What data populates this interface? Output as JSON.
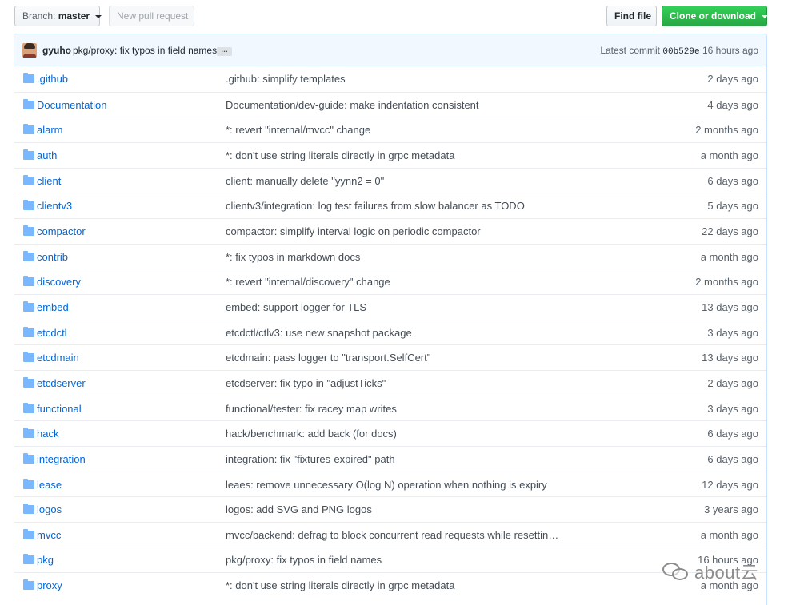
{
  "toolbar": {
    "branch_label": "Branch:",
    "branch_value": "master",
    "new_pr_label": "New pull request",
    "find_file_label": "Find file",
    "clone_label": "Clone or download"
  },
  "commit": {
    "author": "gyuho",
    "message": "pkg/proxy: fix typos in field names",
    "ellipsis": "…",
    "latest_label": "Latest commit",
    "sha": "00b529e",
    "age": "16 hours ago"
  },
  "files": [
    {
      "name": ".github",
      "message": ".github: simplify templates",
      "age": "2 days ago"
    },
    {
      "name": "Documentation",
      "message": "Documentation/dev-guide: make indentation consistent",
      "age": "4 days ago"
    },
    {
      "name": "alarm",
      "message": "*: revert \"internal/mvcc\" change",
      "age": "2 months ago"
    },
    {
      "name": "auth",
      "message": "*: don't use string literals directly in grpc metadata",
      "age": "a month ago"
    },
    {
      "name": "client",
      "message": "client: manually delete \"yynn2 = 0\"",
      "age": "6 days ago"
    },
    {
      "name": "clientv3",
      "message": "clientv3/integration: log test failures from slow balancer as TODO",
      "age": "5 days ago"
    },
    {
      "name": "compactor",
      "message": "compactor: simplify interval logic on periodic compactor",
      "age": "22 days ago"
    },
    {
      "name": "contrib",
      "message": "*: fix typos in markdown docs",
      "age": "a month ago"
    },
    {
      "name": "discovery",
      "message": "*: revert \"internal/discovery\" change",
      "age": "2 months ago"
    },
    {
      "name": "embed",
      "message": "embed: support logger for TLS",
      "age": "13 days ago"
    },
    {
      "name": "etcdctl",
      "message": "etcdctl/ctlv3: use new snapshot package",
      "age": "3 days ago"
    },
    {
      "name": "etcdmain",
      "message": "etcdmain: pass logger to \"transport.SelfCert\"",
      "age": "13 days ago"
    },
    {
      "name": "etcdserver",
      "message": "etcdserver: fix typo in \"adjustTicks\"",
      "age": "2 days ago"
    },
    {
      "name": "functional",
      "message": "functional/tester: fix racey map writes",
      "age": "3 days ago"
    },
    {
      "name": "hack",
      "message": "hack/benchmark: add back (for docs)",
      "age": "6 days ago"
    },
    {
      "name": "integration",
      "message": "integration: fix \"fixtures-expired\" path",
      "age": "6 days ago"
    },
    {
      "name": "lease",
      "message": "leaes: remove unnecessary O(log N) operation when nothing is expiry",
      "age": "12 days ago"
    },
    {
      "name": "logos",
      "message": "logos: add SVG and PNG logos",
      "age": "3 years ago"
    },
    {
      "name": "mvcc",
      "message": "mvcc/backend: defrag to block concurrent read requests while resettin…",
      "age": "a month ago"
    },
    {
      "name": "pkg",
      "message": "pkg/proxy: fix typos in field names",
      "age": "16 hours ago"
    },
    {
      "name": "proxy",
      "message": "*: don't use string literals directly in grpc metadata",
      "age": "a month ago"
    }
  ],
  "watermark": {
    "text": "about云"
  }
}
